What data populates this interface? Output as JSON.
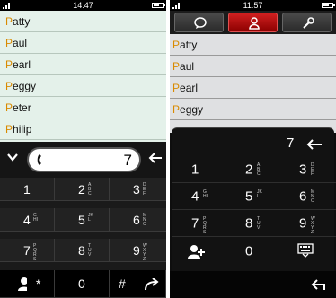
{
  "screenA": {
    "time": "14:47",
    "contacts": [
      {
        "first": "P",
        "rest": "atty"
      },
      {
        "first": "P",
        "rest": "aul"
      },
      {
        "first": "P",
        "rest": "earl"
      },
      {
        "first": "P",
        "rest": "eggy"
      },
      {
        "first": "P",
        "rest": "eter"
      },
      {
        "first": "P",
        "rest": "hilip"
      }
    ],
    "dialed_number": "7",
    "keys": [
      {
        "digit": "1",
        "letters": ""
      },
      {
        "digit": "2",
        "letters": "ABC"
      },
      {
        "digit": "3",
        "letters": "DEF"
      },
      {
        "digit": "4",
        "letters": "GHI"
      },
      {
        "digit": "5",
        "letters": "JKL"
      },
      {
        "digit": "6",
        "letters": "MNO"
      },
      {
        "digit": "7",
        "letters": "PQRS"
      },
      {
        "digit": "8",
        "letters": "TUV"
      },
      {
        "digit": "9",
        "letters": "WXYZ"
      }
    ],
    "bottom_keys": {
      "star": "*",
      "zero": "0",
      "hash": "#"
    }
  },
  "screenB": {
    "time": "11:57",
    "contacts": [
      {
        "first": "P",
        "rest": "atty"
      },
      {
        "first": "P",
        "rest": "aul"
      },
      {
        "first": "P",
        "rest": "earl"
      },
      {
        "first": "P",
        "rest": "eggy"
      }
    ],
    "dialed_number": "7",
    "keys": [
      {
        "digit": "1",
        "letters": ""
      },
      {
        "digit": "2",
        "letters": "ABC"
      },
      {
        "digit": "3",
        "letters": "DEF"
      },
      {
        "digit": "4",
        "letters": "GHI"
      },
      {
        "digit": "5",
        "letters": "JKL"
      },
      {
        "digit": "6",
        "letters": "MNO"
      },
      {
        "digit": "7",
        "letters": "PQRS"
      },
      {
        "digit": "8",
        "letters": "TUV"
      },
      {
        "digit": "9",
        "letters": "WXYZ"
      }
    ],
    "zero": "0",
    "tabs": [
      "chat-bubble-icon",
      "contacts-person-icon",
      "wrench-settings-icon"
    ]
  },
  "colors": {
    "highlight": "#d98a00",
    "active_tab": "#c01818",
    "list_green": "#e4f1ea",
    "list_gray": "#dfe0e2"
  }
}
